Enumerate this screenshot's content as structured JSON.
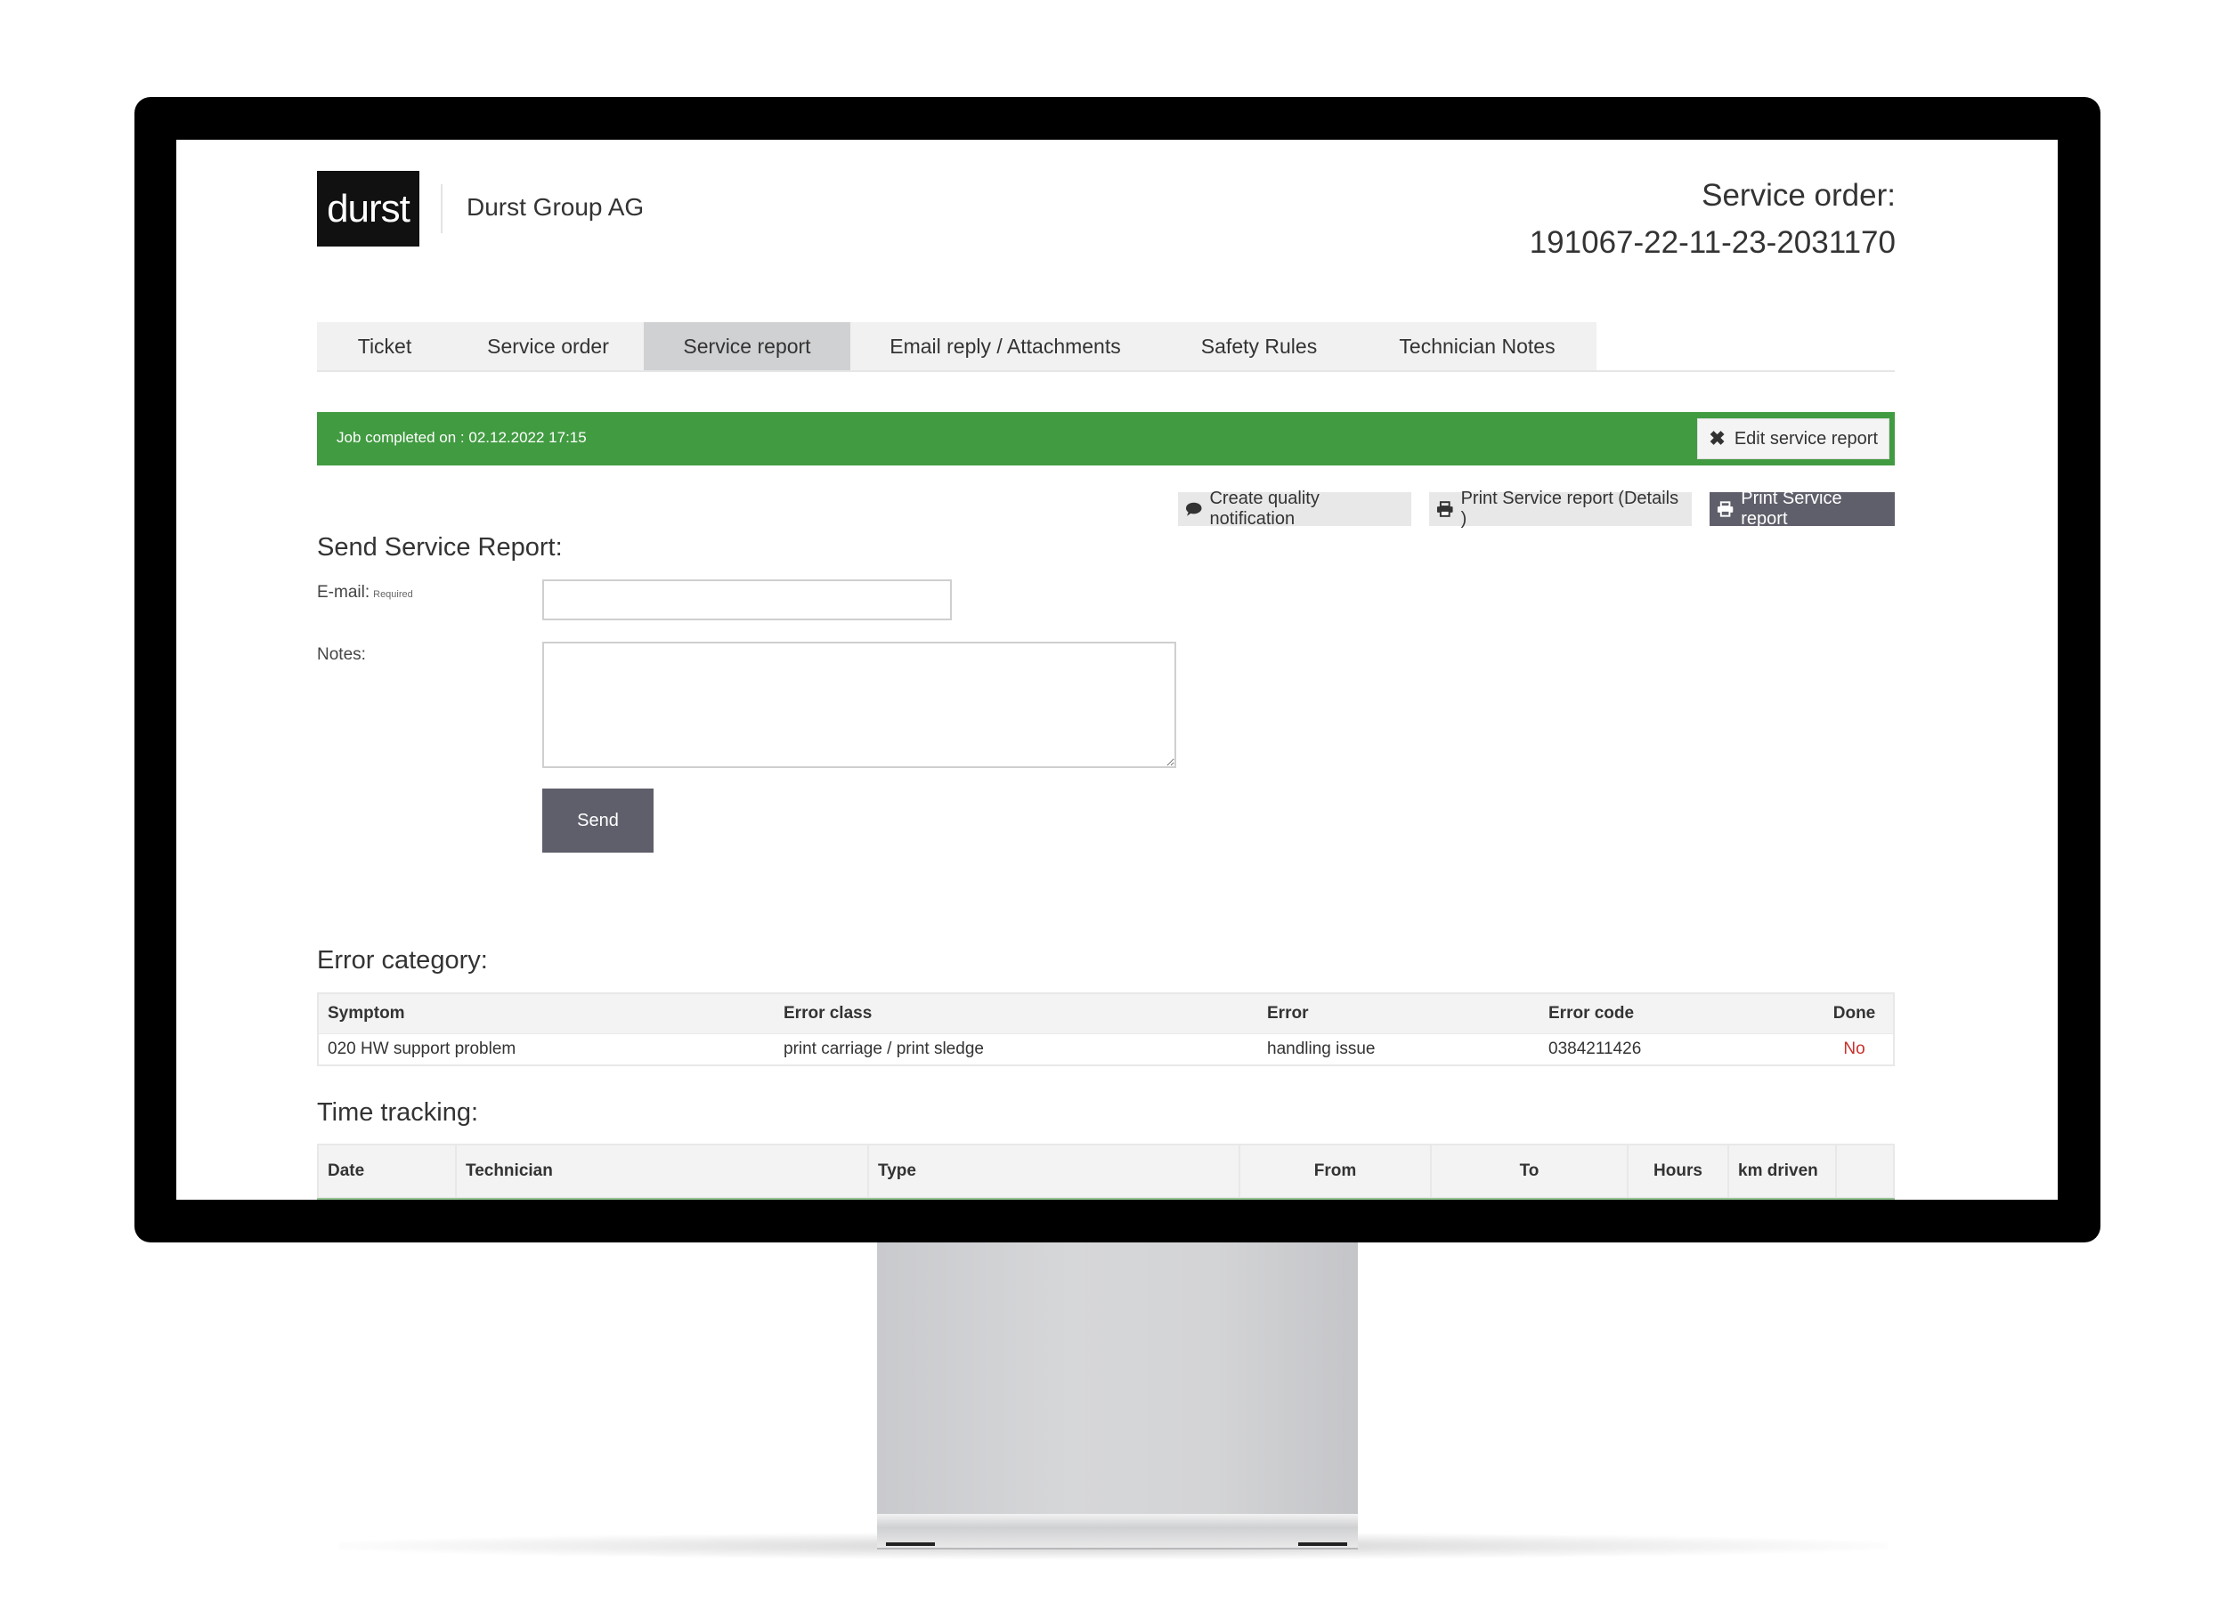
{
  "header": {
    "logo_text": "durst",
    "company_name": "Durst Group AG",
    "order_label": "Service order:",
    "order_number": "191067-22-11-23-2031170"
  },
  "tabs": [
    {
      "label": "Ticket"
    },
    {
      "label": "Service order"
    },
    {
      "label": "Service report",
      "active": true
    },
    {
      "label": "Email reply / Attachments"
    },
    {
      "label": "Safety Rules"
    },
    {
      "label": "Technician Notes"
    }
  ],
  "status": {
    "text": "Job completed on : 02.12.2022 17:15",
    "edit_label": "Edit service report",
    "color": "#419b41"
  },
  "actions": {
    "quality": "Create quality notification",
    "print_details": "Print Service report (Details )",
    "print": "Print Service report"
  },
  "form": {
    "title": "Send Service Report:",
    "email_label": "E-mail:",
    "email_required": "Required",
    "email_value": "",
    "notes_label": "Notes:",
    "notes_value": "",
    "send_label": "Send"
  },
  "error_category": {
    "title": "Error category:",
    "columns": [
      "Symptom",
      "Error class",
      "Error",
      "Error code",
      "Done"
    ],
    "rows": [
      [
        "020 HW support problem",
        "print carriage / print sledge",
        "handling issue",
        "0384211426",
        "No"
      ]
    ],
    "done_no_color": "#c9302c"
  },
  "time_tracking": {
    "title": "Time tracking:",
    "columns": [
      "Date",
      "Technician",
      "Type",
      "From",
      "To",
      "Hours",
      "km driven",
      ""
    ]
  }
}
